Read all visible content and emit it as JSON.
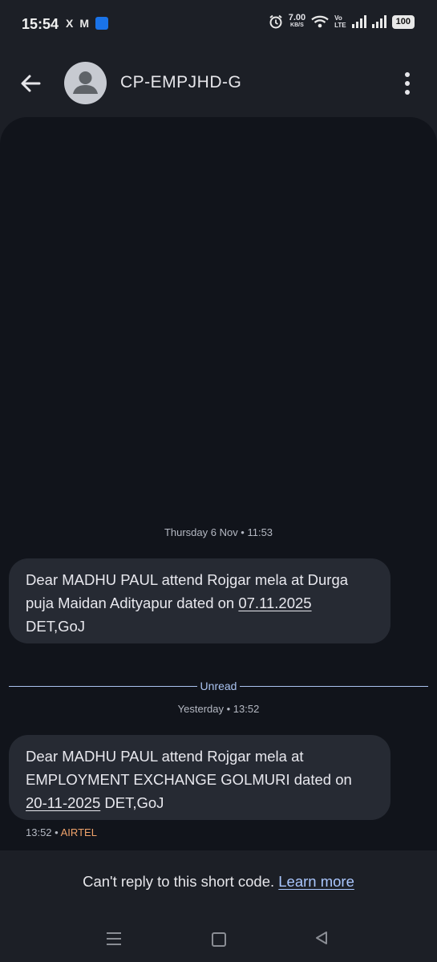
{
  "status_bar": {
    "time": "15:54",
    "notification_icons": [
      "x-icon",
      "gmail-icon",
      "app-icon"
    ],
    "x_glyph": "X",
    "gmail_glyph": "M",
    "net_speed": "7.00",
    "net_speed_unit": "KB/S",
    "volte_top": "Vo",
    "volte_bottom": "LTE",
    "battery": "100"
  },
  "app_bar": {
    "contact_name": "CP-EMPJHD-G"
  },
  "messages": [
    {
      "timestamp": "Thursday 6 Nov • 11:53",
      "text_before": "Dear MADHU  PAUL attend Rojgar mela at Durga puja Maidan Adityapur dated on ",
      "date_link": "07.11.2025",
      "text_after": " DET,GoJ"
    },
    {
      "timestamp": "Yesterday • 13:52",
      "text_before": "Dear MADHU  PAUL attend Rojgar mela at EMPLOYMENT EXCHANGE GOLMURI dated on ",
      "date_link": "20-11-2025",
      "text_after": " DET,GoJ"
    }
  ],
  "unread_label": "Unread",
  "last_message_meta": {
    "time": "13:52",
    "separator": "•",
    "sim": "AIRTEL"
  },
  "reply_notice": {
    "text": "Can't reply to this short code.",
    "link": "Learn more"
  },
  "colors": {
    "background": "#1c1f26",
    "conversation": "#11141b",
    "bubble": "#262a33",
    "accent": "#aac7ff",
    "sim_label": "#f0a36b"
  }
}
